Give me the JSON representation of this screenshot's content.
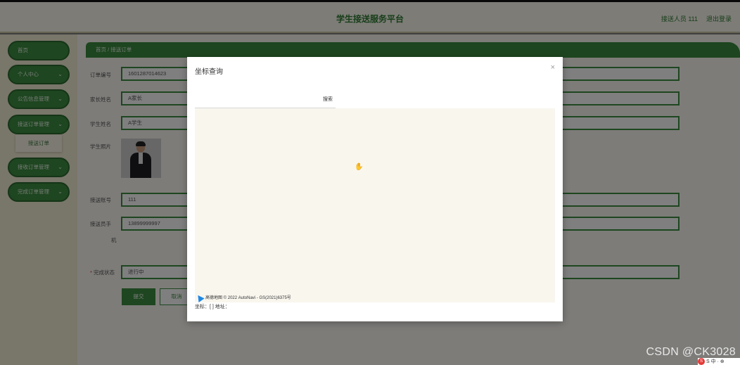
{
  "header": {
    "title": "学生接送服务平台",
    "user": "接送人员 111",
    "logout": "退出登录"
  },
  "sidebar": {
    "items": [
      {
        "label": "首页",
        "chevron": ""
      },
      {
        "label": "个人中心",
        "chevron": "⌄"
      },
      {
        "label": "公告信息管理",
        "chevron": "⌄"
      },
      {
        "label": "接送订单管理",
        "chevron": "⌄"
      },
      {
        "label": "接收订单管理",
        "chevron": "⌄"
      },
      {
        "label": "完成订单管理",
        "chevron": "⌄"
      }
    ],
    "sub_item": "接送订单"
  },
  "breadcrumb": "首页 / 接送订单",
  "form": {
    "order_no_label": "订单编号",
    "order_no": "1601287014623",
    "parent_label": "家长姓名",
    "parent": "A家长",
    "student_label": "学生姓名",
    "student": "A学生",
    "photo_label": "学生照片",
    "account_label": "接送账号",
    "account": "111",
    "phone_label_1": "接送员手",
    "phone_label_2": "机",
    "phone": "13899999997",
    "status_label": "完成状态",
    "status": "进行中",
    "submit": "提交",
    "cancel": "取消"
  },
  "modal": {
    "title": "坐标查询",
    "close": "×",
    "search_button": "搜索",
    "attribution": "高德地图 © 2022 AutoNavi - GS(2021)6375号",
    "coords_text": "坐标：[ ] 地址："
  },
  "watermark": "CSDN @CK3028",
  "ime": "S 中 · ⊕"
}
